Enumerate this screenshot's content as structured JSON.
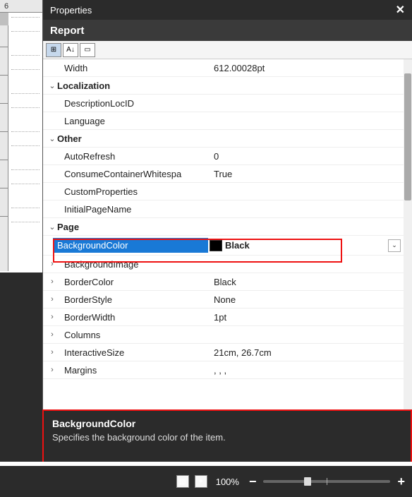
{
  "ruler": {
    "topValue": "6"
  },
  "panel": {
    "title": "Properties",
    "close": "✕",
    "subtitle": "Report",
    "toolbar": {
      "btnCategorized": "⊞",
      "btnAlpha": "A↓",
      "btnPages": "▭"
    }
  },
  "grid": {
    "widthLabel": "Width",
    "widthValue": "612.00028pt",
    "catLocalization": "Localization",
    "descLocId": "DescriptionLocID",
    "language": "Language",
    "catOther": "Other",
    "autoRefresh": "AutoRefresh",
    "autoRefreshVal": "0",
    "consumeWs": "ConsumeContainerWhitespa",
    "consumeWsVal": "True",
    "customProps": "CustomProperties",
    "initPage": "InitialPageName",
    "catPage": "Page",
    "bgColor": "BackgroundColor",
    "bgColorVal": "Black",
    "bgImage": "BackgroundImage",
    "borderColor": "BorderColor",
    "borderColorVal": "Black",
    "borderStyle": "BorderStyle",
    "borderStyleVal": "None",
    "borderWidth": "BorderWidth",
    "borderWidthVal": "1pt",
    "columns": "Columns",
    "interactiveSize": "InteractiveSize",
    "interactiveSizeVal": "21cm, 26.7cm",
    "margins": "Margins",
    "marginsVal": ", , ,"
  },
  "description": {
    "title": "BackgroundColor",
    "text": "Specifies the background color of the item."
  },
  "statusbar": {
    "zoom": "100%",
    "minus": "−",
    "plus": "+"
  }
}
